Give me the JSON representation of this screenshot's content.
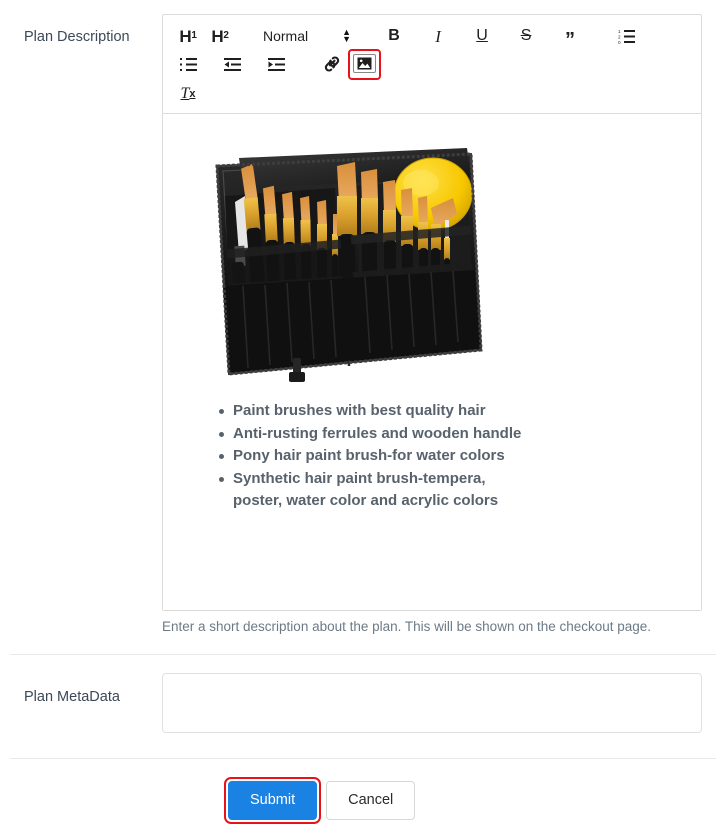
{
  "form": {
    "description_label": "Plan Description",
    "metadata_label": "Plan MetaData",
    "description_help": "Enter a short description about the plan. This will be shown on the checkout page.",
    "metadata_value": "",
    "metadata_placeholder": ""
  },
  "editor": {
    "toolbar": {
      "h1": "H",
      "h1_sub": "1",
      "h2": "H",
      "h2_sub": "2",
      "style_picker_value": "Normal",
      "bold": "B",
      "italic": "I",
      "underline": "U",
      "strikethrough": "S",
      "blockquote": "”",
      "clear_format": "T",
      "clear_format_sub": "x",
      "ordered_list_name": "ordered-list-icon",
      "bullet_list_name": "bullet-list-icon",
      "outdent_name": "outdent-icon",
      "indent_name": "indent-icon",
      "link_name": "link-icon",
      "image_name": "image-icon"
    },
    "content": {
      "image_alt": "Paint brush set in black zippered case with yellow palette",
      "bullets": [
        "Paint brushes with best quality hair",
        "Anti-rusting ferrules and wooden handle",
        "Pony hair paint brush-for water colors",
        "Synthetic hair paint brush-tempera, poster, water color and acrylic colors"
      ]
    }
  },
  "actions": {
    "submit_label": "Submit",
    "cancel_label": "Cancel"
  },
  "colors": {
    "primary_blue": "#1a82e2",
    "annotation_red": "#e8131a",
    "label_text": "#3c4858",
    "bullet_text": "#58626d",
    "help_text": "#6d7a86",
    "border": "#dcdcdc"
  }
}
